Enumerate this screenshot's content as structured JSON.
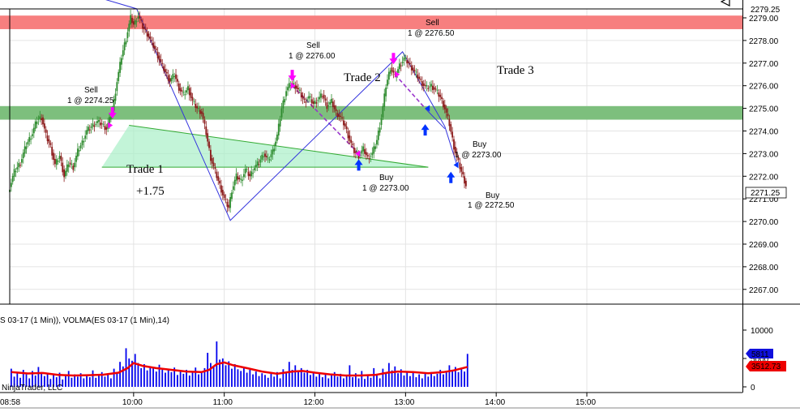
{
  "chart_data": {
    "type": "candlestick",
    "instrument_label": "S 03-17 (1 Min)), VOLMA(ES 03-17 (1 Min),14)",
    "watermark": "NinjaTrader, LLC",
    "price_axis": {
      "range": [
        2266.0,
        2279.5
      ],
      "ticks": [
        "2279.00",
        "2278.00",
        "2277.00",
        "2276.00",
        "2275.00",
        "2274.00",
        "2273.00",
        "2272.00",
        "2271.00",
        "2270.00",
        "2269.00",
        "2268.00",
        "2267.00"
      ],
      "last_price": "2271.25",
      "top_value": "2279.25"
    },
    "volume_axis": {
      "range": [
        0,
        14000
      ],
      "ticks": [
        "10000",
        "5000",
        "0"
      ],
      "last_volume": "5811",
      "volma_value": "3512.73"
    },
    "time_axis": {
      "range_minutes": [
        518,
        1003
      ],
      "ticks": [
        {
          "t": 600,
          "label": "10:00"
        },
        {
          "t": 660,
          "label": "11:00"
        },
        {
          "t": 720,
          "label": "12:00"
        },
        {
          "t": 780,
          "label": "13:00"
        },
        {
          "t": 840,
          "label": "14:00"
        },
        {
          "t": 900,
          "label": "15:00"
        }
      ],
      "left_label": "08:58"
    },
    "zones": [
      {
        "low": 2278.5,
        "high": 2279.1,
        "color": "#f77f7f"
      },
      {
        "low": 2274.5,
        "high": 2275.1,
        "color": "#7dbf7d"
      }
    ],
    "price_path": [
      [
        518,
        2271.3
      ],
      [
        522,
        2272.2
      ],
      [
        526,
        2272.6
      ],
      [
        530,
        2273.4
      ],
      [
        534,
        2273.9
      ],
      [
        537,
        2274.5
      ],
      [
        540,
        2274.6
      ],
      [
        543,
        2273.8
      ],
      [
        546,
        2273.3
      ],
      [
        549,
        2272.5
      ],
      [
        552,
        2272.9
      ],
      [
        555,
        2272.0
      ],
      [
        558,
        2272.6
      ],
      [
        561,
        2272.4
      ],
      [
        564,
        2273.1
      ],
      [
        567,
        2273.5
      ],
      [
        570,
        2274.0
      ],
      [
        573,
        2274.2
      ],
      [
        577,
        2274.4
      ],
      [
        580,
        2274.3
      ],
      [
        583,
        2274.1
      ],
      [
        587,
        2274.9
      ],
      [
        590,
        2276.2
      ],
      [
        593,
        2277.3
      ],
      [
        596,
        2278.1
      ],
      [
        599,
        2279.0
      ],
      [
        601,
        2278.7
      ],
      [
        604,
        2279.1
      ],
      [
        607,
        2278.6
      ],
      [
        610,
        2278.3
      ],
      [
        613,
        2277.9
      ],
      [
        616,
        2277.5
      ],
      [
        619,
        2277.0
      ],
      [
        622,
        2276.6
      ],
      [
        625,
        2276.2
      ],
      [
        628,
        2276.5
      ],
      [
        631,
        2275.9
      ],
      [
        634,
        2275.6
      ],
      [
        637,
        2275.9
      ],
      [
        640,
        2275.3
      ],
      [
        643,
        2275.0
      ],
      [
        646,
        2274.8
      ],
      [
        649,
        2273.9
      ],
      [
        652,
        2272.8
      ],
      [
        655,
        2272.2
      ],
      [
        658,
        2271.6
      ],
      [
        661,
        2271.0
      ],
      [
        664,
        2270.6
      ],
      [
        666,
        2271.4
      ],
      [
        669,
        2272.0
      ],
      [
        672,
        2271.8
      ],
      [
        675,
        2272.3
      ],
      [
        678,
        2272.0
      ],
      [
        681,
        2272.4
      ],
      [
        684,
        2272.6
      ],
      [
        687,
        2273.0
      ],
      [
        690,
        2272.7
      ],
      [
        693,
        2273.1
      ],
      [
        696,
        2273.8
      ],
      [
        699,
        2275.0
      ],
      [
        702,
        2275.8
      ],
      [
        705,
        2276.1
      ],
      [
        708,
        2276.0
      ],
      [
        711,
        2275.7
      ],
      [
        714,
        2275.3
      ],
      [
        717,
        2275.5
      ],
      [
        720,
        2275.2
      ],
      [
        723,
        2275.4
      ],
      [
        726,
        2275.6
      ],
      [
        729,
        2275.1
      ],
      [
        732,
        2275.3
      ],
      [
        735,
        2274.8
      ],
      [
        738,
        2274.6
      ],
      [
        741,
        2274.2
      ],
      [
        744,
        2273.6
      ],
      [
        747,
        2273.1
      ],
      [
        750,
        2272.9
      ],
      [
        753,
        2273.2
      ],
      [
        756,
        2272.8
      ],
      [
        759,
        2273.0
      ],
      [
        762,
        2273.6
      ],
      [
        765,
        2274.6
      ],
      [
        768,
        2276.0
      ],
      [
        771,
        2276.8
      ],
      [
        774,
        2276.4
      ],
      [
        777,
        2276.9
      ],
      [
        780,
        2277.2
      ],
      [
        783,
        2277.0
      ],
      [
        786,
        2276.7
      ],
      [
        789,
        2276.4
      ],
      [
        792,
        2276.1
      ],
      [
        795,
        2275.9
      ],
      [
        798,
        2276.0
      ],
      [
        801,
        2275.8
      ],
      [
        804,
        2275.5
      ],
      [
        807,
        2275.0
      ],
      [
        810,
        2274.3
      ],
      [
        813,
        2273.3
      ],
      [
        816,
        2272.6
      ],
      [
        819,
        2272.0
      ],
      [
        821,
        2271.6
      ]
    ],
    "volume": [
      [
        519,
        3200
      ],
      [
        521,
        1800
      ],
      [
        523,
        2500
      ],
      [
        525,
        1600
      ],
      [
        527,
        3000
      ],
      [
        529,
        2200
      ],
      [
        531,
        1500
      ],
      [
        533,
        2800
      ],
      [
        535,
        2000
      ],
      [
        537,
        3500
      ],
      [
        539,
        2600
      ],
      [
        541,
        1900
      ],
      [
        543,
        2300
      ],
      [
        545,
        1400
      ],
      [
        547,
        2100
      ],
      [
        549,
        1700
      ],
      [
        551,
        2500
      ],
      [
        553,
        1300
      ],
      [
        555,
        1900
      ],
      [
        557,
        2800
      ],
      [
        559,
        1600
      ],
      [
        561,
        2200
      ],
      [
        563,
        1800
      ],
      [
        565,
        2400
      ],
      [
        567,
        1500
      ],
      [
        569,
        2000
      ],
      [
        571,
        1700
      ],
      [
        573,
        2900
      ],
      [
        575,
        1600
      ],
      [
        577,
        2100
      ],
      [
        579,
        2600
      ],
      [
        581,
        1800
      ],
      [
        583,
        2300
      ],
      [
        585,
        1500
      ],
      [
        587,
        3200
      ],
      [
        589,
        2500
      ],
      [
        591,
        4400
      ],
      [
        593,
        3600
      ],
      [
        595,
        6800
      ],
      [
        597,
        5000
      ],
      [
        599,
        4600
      ],
      [
        601,
        5800
      ],
      [
        603,
        4200
      ],
      [
        605,
        3300
      ],
      [
        607,
        4000
      ],
      [
        609,
        2900
      ],
      [
        611,
        3600
      ],
      [
        613,
        3400
      ],
      [
        615,
        2700
      ],
      [
        617,
        3900
      ],
      [
        619,
        3000
      ],
      [
        621,
        2500
      ],
      [
        623,
        3200
      ],
      [
        625,
        2600
      ],
      [
        627,
        3400
      ],
      [
        629,
        2100
      ],
      [
        631,
        2900
      ],
      [
        633,
        2300
      ],
      [
        635,
        3000
      ],
      [
        637,
        2000
      ],
      [
        639,
        2600
      ],
      [
        641,
        3400
      ],
      [
        643,
        2200
      ],
      [
        645,
        2700
      ],
      [
        647,
        3300
      ],
      [
        649,
        6000
      ],
      [
        651,
        4200
      ],
      [
        653,
        3500
      ],
      [
        655,
        8000
      ],
      [
        657,
        4800
      ],
      [
        659,
        5000
      ],
      [
        661,
        3800
      ],
      [
        663,
        4500
      ],
      [
        665,
        3200
      ],
      [
        667,
        4000
      ],
      [
        669,
        3100
      ],
      [
        671,
        2800
      ],
      [
        673,
        3500
      ],
      [
        675,
        2500
      ],
      [
        677,
        3000
      ],
      [
        679,
        2200
      ],
      [
        681,
        2700
      ],
      [
        683,
        1900
      ],
      [
        685,
        2400
      ],
      [
        687,
        2100
      ],
      [
        689,
        1600
      ],
      [
        691,
        2300
      ],
      [
        693,
        1800
      ],
      [
        695,
        2600
      ],
      [
        697,
        1500
      ],
      [
        699,
        3100
      ],
      [
        701,
        2400
      ],
      [
        703,
        4400
      ],
      [
        705,
        3000
      ],
      [
        707,
        3800
      ],
      [
        709,
        2700
      ],
      [
        711,
        3300
      ],
      [
        713,
        2500
      ],
      [
        715,
        3000
      ],
      [
        717,
        2100
      ],
      [
        719,
        2700
      ],
      [
        721,
        1800
      ],
      [
        723,
        2400
      ],
      [
        725,
        1700
      ],
      [
        727,
        2200
      ],
      [
        729,
        1500
      ],
      [
        731,
        2000
      ],
      [
        733,
        2600
      ],
      [
        735,
        1800
      ],
      [
        737,
        2300
      ],
      [
        739,
        1500
      ],
      [
        741,
        2000
      ],
      [
        743,
        3800
      ],
      [
        745,
        1700
      ],
      [
        747,
        2400
      ],
      [
        749,
        1500
      ],
      [
        751,
        2800
      ],
      [
        753,
        1400
      ],
      [
        755,
        2000
      ],
      [
        757,
        1600
      ],
      [
        759,
        3300
      ],
      [
        761,
        2300
      ],
      [
        763,
        1500
      ],
      [
        765,
        3200
      ],
      [
        767,
        2500
      ],
      [
        769,
        4200
      ],
      [
        771,
        2900
      ],
      [
        773,
        3600
      ],
      [
        775,
        2400
      ],
      [
        777,
        3100
      ],
      [
        779,
        2000
      ],
      [
        781,
        2700
      ],
      [
        783,
        1900
      ],
      [
        785,
        2600
      ],
      [
        787,
        1700
      ],
      [
        789,
        2200
      ],
      [
        791,
        1500
      ],
      [
        793,
        2400
      ],
      [
        795,
        1800
      ],
      [
        797,
        2600
      ],
      [
        799,
        1900
      ],
      [
        801,
        2300
      ],
      [
        803,
        3000
      ],
      [
        805,
        2200
      ],
      [
        807,
        2700
      ],
      [
        809,
        3800
      ],
      [
        811,
        2900
      ],
      [
        813,
        3500
      ],
      [
        815,
        2600
      ],
      [
        817,
        3200
      ],
      [
        819,
        2700
      ],
      [
        821,
        5811
      ]
    ],
    "volma": [
      [
        519,
        2600
      ],
      [
        530,
        2350
      ],
      [
        540,
        2450
      ],
      [
        550,
        2100
      ],
      [
        560,
        2000
      ],
      [
        570,
        2050
      ],
      [
        580,
        2150
      ],
      [
        590,
        2500
      ],
      [
        596,
        3300
      ],
      [
        600,
        4200
      ],
      [
        606,
        3700
      ],
      [
        615,
        3300
      ],
      [
        625,
        3000
      ],
      [
        635,
        2700
      ],
      [
        645,
        2600
      ],
      [
        650,
        3000
      ],
      [
        655,
        4000
      ],
      [
        660,
        4300
      ],
      [
        666,
        3800
      ],
      [
        675,
        3300
      ],
      [
        685,
        2700
      ],
      [
        695,
        2300
      ],
      [
        705,
        2700
      ],
      [
        712,
        2800
      ],
      [
        720,
        2500
      ],
      [
        730,
        2200
      ],
      [
        740,
        2000
      ],
      [
        750,
        2000
      ],
      [
        760,
        2100
      ],
      [
        768,
        2500
      ],
      [
        775,
        2700
      ],
      [
        785,
        2600
      ],
      [
        795,
        2400
      ],
      [
        805,
        2600
      ],
      [
        812,
        2900
      ],
      [
        821,
        3512.73
      ]
    ],
    "trades": [
      {
        "name": "Trade 1",
        "result": "+1.75"
      },
      {
        "name": "Trade 2"
      },
      {
        "name": "Trade 3"
      }
    ],
    "trade_fills": [
      {
        "side": "Sell",
        "label": "1 @ 2274.25"
      },
      {
        "side": "Sell",
        "label": "1 @ 2276.00"
      },
      {
        "side": "Buy",
        "label": "1 @ 2273.00"
      },
      {
        "side": "Sell",
        "label": "1 @ 2276.50"
      },
      {
        "side": "Buy",
        "label": "1 @ 2273.00"
      },
      {
        "side": "Buy",
        "label": "1 @ 2272.50"
      }
    ],
    "colors": {
      "up_bar": "#2e8b2e",
      "down_bar": "#8b1a1a",
      "volume_bar": "#0000ee",
      "volma_line": "#ee0000",
      "zigzag": "#3333dd",
      "trade_fill": "#aaf0c8",
      "trade_line": "#33aa33",
      "trade2_line": "#9933cc",
      "sell_marker": "#ff00ff",
      "buy_marker": "#0033ff"
    },
    "grid": true
  }
}
